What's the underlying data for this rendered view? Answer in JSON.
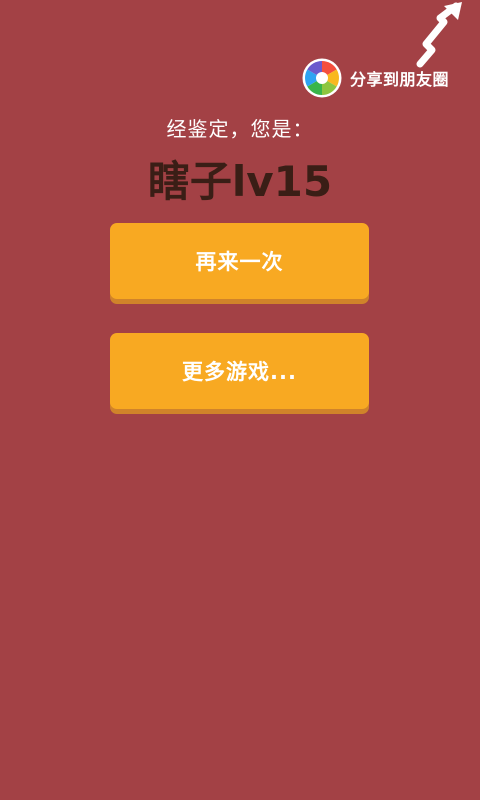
{
  "share": {
    "label": "分享到朋友圈",
    "icon": "camera-aperture-icon",
    "arrow_icon": "arrow-up-icon"
  },
  "result": {
    "intro": "经鉴定，您是：",
    "title": "瞎子lv15"
  },
  "buttons": {
    "retry": "再来一次",
    "more_games": "更多游戏..."
  },
  "colors": {
    "background": "#a34145",
    "button": "#f8a922",
    "button_shadow": "#d0832a",
    "title_text": "#3a1e16",
    "text": "#ffffff"
  }
}
